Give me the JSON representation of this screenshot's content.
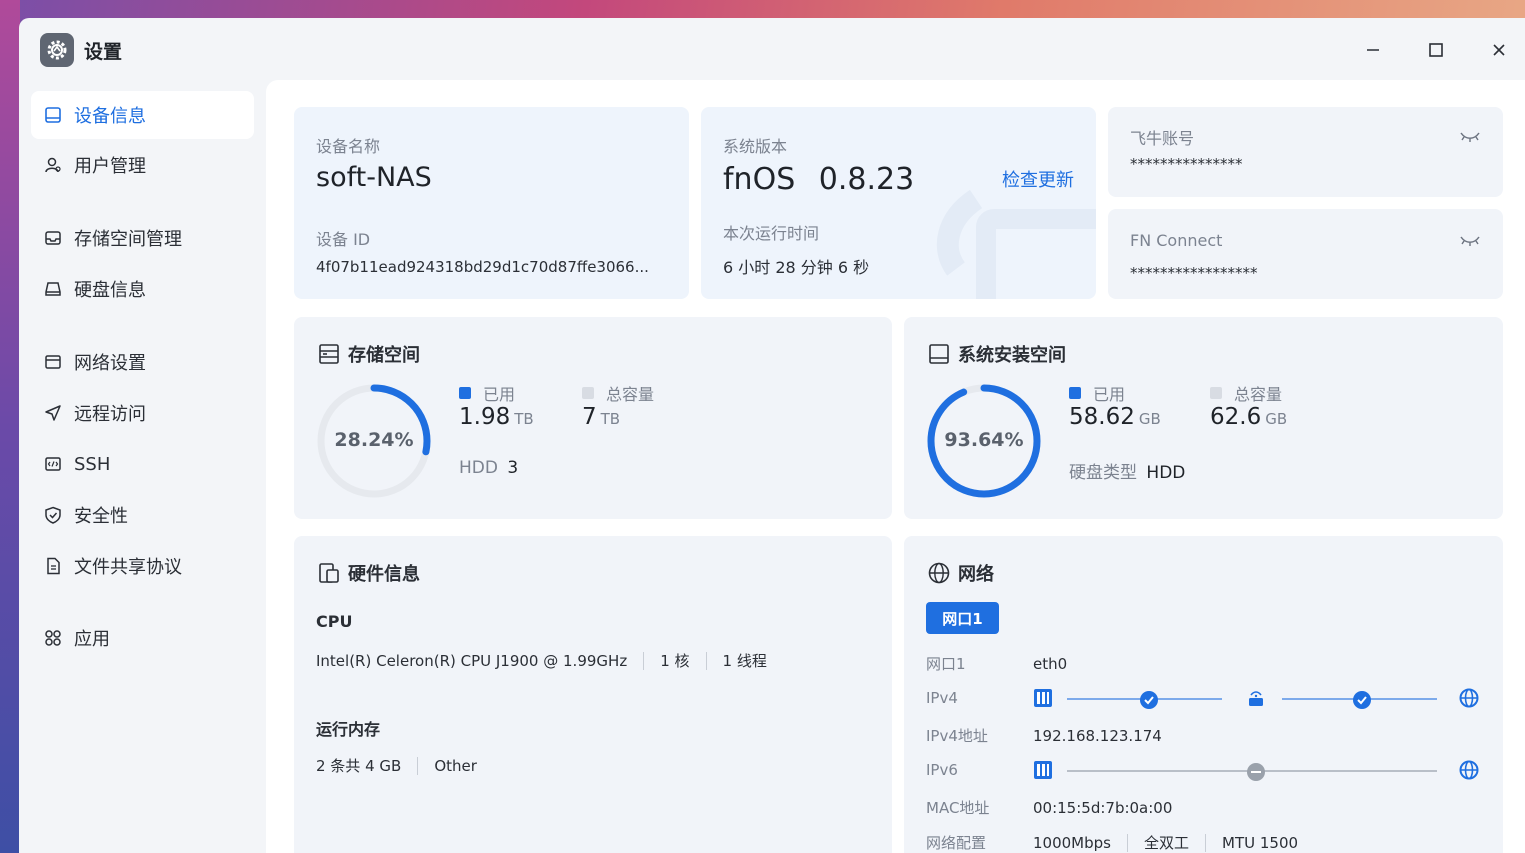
{
  "window": {
    "title": "设置"
  },
  "sidebar": {
    "items": [
      {
        "label": "设备信息",
        "icon": "device-icon",
        "active": true
      },
      {
        "label": "用户管理",
        "icon": "user-icon"
      },
      {
        "label": "存储空间管理",
        "icon": "storage-icon"
      },
      {
        "label": "硬盘信息",
        "icon": "disk-icon"
      },
      {
        "label": "网络设置",
        "icon": "network-settings-icon"
      },
      {
        "label": "远程访问",
        "icon": "remote-access-icon"
      },
      {
        "label": "SSH",
        "icon": "ssh-icon"
      },
      {
        "label": "安全性",
        "icon": "shield-icon"
      },
      {
        "label": "文件共享协议",
        "icon": "file-share-icon"
      },
      {
        "label": "应用",
        "icon": "apps-icon"
      }
    ]
  },
  "device": {
    "name_label": "设备名称",
    "name": "soft-NAS",
    "id_label": "设备 ID",
    "id": "4f07b11ead924318bd29d1c70d87ffe3066..."
  },
  "system": {
    "version_label": "系统版本",
    "os": "fnOS",
    "version": "0.8.23",
    "check_update": "检查更新",
    "uptime_label": "本次运行时间",
    "uptime": "6 小时 28 分钟 6 秒"
  },
  "accounts": {
    "feiniu_label": "飞牛账号",
    "feiniu_value": "***************",
    "fnconnect_label": "FN Connect",
    "fnconnect_value": "*****************"
  },
  "storage": {
    "title": "存储空间",
    "percent_text": "28.24%",
    "percent": 28.24,
    "used_label": "已用",
    "used_value": "1.98",
    "used_unit": "TB",
    "total_label": "总容量",
    "total_value": "7",
    "total_unit": "TB",
    "disk_type": "HDD",
    "disk_count": "3"
  },
  "sys_install": {
    "title": "系统安装空间",
    "percent_text": "93.64%",
    "percent": 93.64,
    "used_label": "已用",
    "used_value": "58.62",
    "used_unit": "GB",
    "total_label": "总容量",
    "total_value": "62.6",
    "total_unit": "GB",
    "disk_type_label": "硬盘类型",
    "disk_type": "HDD"
  },
  "hardware": {
    "title": "硬件信息",
    "cpu_label": "CPU",
    "cpu_model": "Intel(R) Celeron(R) CPU J1900 @ 1.99GHz",
    "cpu_cores": "1 核",
    "cpu_threads": "1 线程",
    "mem_label": "运行内存",
    "mem_summary": "2 条共 4 GB",
    "mem_type": "Other"
  },
  "network": {
    "title": "网络",
    "tab": "网口1",
    "port_label": "网口1",
    "port_value": "eth0",
    "ipv4_label": "IPv4",
    "ipv4_addr_label": "IPv4地址",
    "ipv4_addr": "192.168.123.174",
    "ipv6_label": "IPv6",
    "mac_label": "MAC地址",
    "mac": "00:15:5d:7b:0a:00",
    "config_label": "网络配置",
    "speed": "1000Mbps",
    "duplex": "全双工",
    "mtu": "MTU 1500"
  },
  "colors": {
    "accent": "#1f6fe0",
    "ring_track": "#e6e9ee",
    "legend_total": "#d8dce3"
  }
}
